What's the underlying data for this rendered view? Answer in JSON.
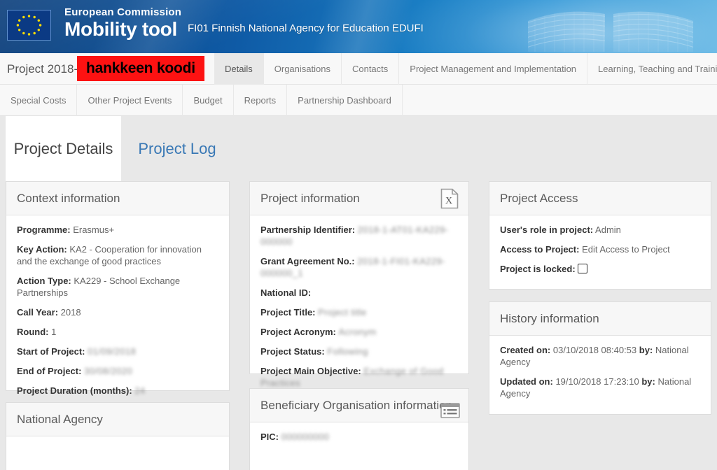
{
  "banner": {
    "logo_alt": "European Union flag",
    "commission": "European Commission",
    "product": "Mobility tool",
    "agency": "FI01 Finnish National Agency for Education EDUFI"
  },
  "nav": {
    "project_label": "Project 2018-1",
    "redaction_text": "hankkeen koodi",
    "redaction_color": "#fd1212",
    "tabs": [
      {
        "label": "Details",
        "active": true
      },
      {
        "label": "Organisations",
        "active": false
      },
      {
        "label": "Contacts",
        "active": false
      },
      {
        "label": "Project Management and Implementation",
        "active": false
      },
      {
        "label": "Learning, Teaching and Training Activities",
        "active": false
      }
    ],
    "tabs2": [
      {
        "label": "Special Costs"
      },
      {
        "label": "Other Project Events"
      },
      {
        "label": "Budget"
      },
      {
        "label": "Reports"
      },
      {
        "label": "Partnership Dashboard"
      }
    ]
  },
  "subtabs": {
    "active_label": "Project Details",
    "inactive_label": "Project Log",
    "link_color": "#3978b5"
  },
  "context_information": {
    "title": "Context information",
    "rows": [
      {
        "label": "Programme:",
        "value": "Erasmus+",
        "blurred": false
      },
      {
        "label": "Key Action:",
        "value": "KA2 - Cooperation for innovation and the exchange of good practices",
        "blurred": false
      },
      {
        "label": "Action Type:",
        "value": "KA229 - School Exchange Partnerships",
        "blurred": false
      },
      {
        "label": "Call Year:",
        "value": "2018",
        "blurred": false
      },
      {
        "label": "Round:",
        "value": "1",
        "blurred": false
      },
      {
        "label": "Start of Project:",
        "value": "01/09/2018",
        "blurred": true
      },
      {
        "label": "End of Project:",
        "value": "30/08/2020",
        "blurred": true
      },
      {
        "label": "Project Duration (months):",
        "value": "24",
        "blurred": true
      }
    ]
  },
  "project_information": {
    "title": "Project information",
    "export_icon": "excel-export-icon",
    "rows": [
      {
        "label": "Partnership Identifier:",
        "value": "2018-1-AT01-KA229-000000",
        "blurred": true
      },
      {
        "label": "Grant Agreement No.:",
        "value": "2018-1-FI01-KA229-000000_1",
        "blurred": true
      },
      {
        "label": "National ID:",
        "value": "",
        "blurred": false
      },
      {
        "label": "Project Title:",
        "value": "Project title",
        "blurred": true
      },
      {
        "label": "Project Acronym:",
        "value": "Acronym",
        "blurred": true
      },
      {
        "label": "Project Status:",
        "value": "Following",
        "blurred": true
      },
      {
        "label": "Project Main Objective:",
        "value": "Exchange of Good Practices",
        "blurred": true
      }
    ]
  },
  "project_access": {
    "title": "Project Access",
    "rows": [
      {
        "label": "User's role in project:",
        "value": "Admin"
      },
      {
        "label": "Access to Project:",
        "value": "Edit Access to Project"
      }
    ],
    "locked_label": "Project is locked:",
    "locked_checked": false
  },
  "history_information": {
    "title": "History information",
    "rows": [
      {
        "label": "Created on:",
        "value": "03/10/2018 08:40:53",
        "by_label": "by:",
        "by_value": "National Agency"
      },
      {
        "label": "Updated on:",
        "value": "19/10/2018 17:23:10",
        "by_label": "by:",
        "by_value": "National Agency"
      }
    ]
  },
  "national_agency": {
    "title": "National Agency"
  },
  "beneficiary_organisation": {
    "title": "Beneficiary Organisation information",
    "list_icon": "list-details-icon",
    "rows": [
      {
        "label": "PIC:",
        "value": "000000000",
        "blurred": true
      }
    ]
  }
}
